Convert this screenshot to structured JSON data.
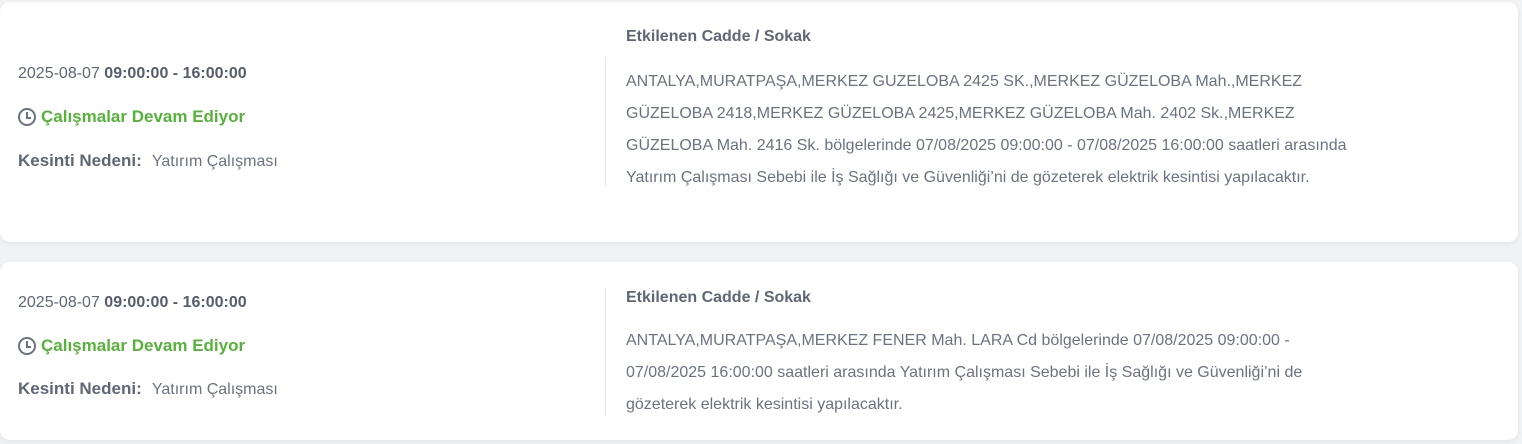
{
  "outages": [
    {
      "date": "2025-08-07",
      "time_range": "09:00:00 - 16:00:00",
      "status": "Çalışmalar Devam Ediyor",
      "status_icon": "clock-icon",
      "reason_label": "Kesinti Nedeni:",
      "reason_value": "Yatırım Çalışması",
      "affected_heading": "Etkilenen Cadde / Sokak",
      "affected_text": "ANTALYA,MURATPAŞA,MERKEZ GUZELOBA 2425 SK.,MERKEZ GÜZELOBA Mah.,MERKEZ GÜZELOBA 2418,MERKEZ GÜZELOBA 2425,MERKEZ GÜZELOBA Mah. 2402 Sk.,MERKEZ GÜZELOBA Mah. 2416 Sk. bölgelerinde 07/08/2025 09:00:00 - 07/08/2025 16:00:00 saatleri arasında Yatırım Çalışması Sebebi ile İş Sağlığı ve Güvenliği’ni de gözeterek elektrik kesintisi yapılacaktır."
    },
    {
      "date": "2025-08-07",
      "time_range": "09:00:00 - 16:00:00",
      "status": "Çalışmalar Devam Ediyor",
      "status_icon": "clock-icon",
      "reason_label": "Kesinti Nedeni:",
      "reason_value": "Yatırım Çalışması",
      "affected_heading": "Etkilenen Cadde / Sokak",
      "affected_text": "ANTALYA,MURATPAŞA,MERKEZ FENER Mah. LARA Cd bölgelerinde 07/08/2025 09:00:00 - 07/08/2025 16:00:00 saatleri arasında Yatırım Çalışması Sebebi ile İş Sağlığı ve Güvenliği’ni de gözeterek elektrik kesintisi yapılacaktır."
    }
  ],
  "colors": {
    "status_green": "#56b33a",
    "text_gray": "#5f6774",
    "background": "#f1f2f4",
    "card": "#ffffff"
  }
}
